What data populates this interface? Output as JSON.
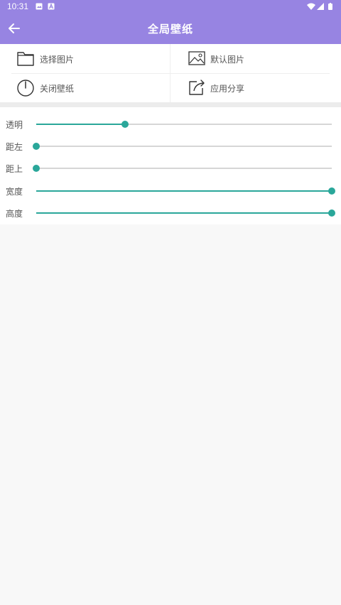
{
  "status_bar": {
    "time": "10:31"
  },
  "app_bar": {
    "title": "全局壁纸"
  },
  "actions": [
    {
      "label": "选择图片",
      "icon": "folder-icon"
    },
    {
      "label": "默认图片",
      "icon": "image-icon"
    },
    {
      "label": "关闭壁纸",
      "icon": "power-icon"
    },
    {
      "label": "应用分享",
      "icon": "share-icon"
    }
  ],
  "sliders": [
    {
      "label": "透明",
      "value": 0.3
    },
    {
      "label": "距左",
      "value": 0.0
    },
    {
      "label": "距上",
      "value": 0.0
    },
    {
      "label": "宽度",
      "value": 1.0
    },
    {
      "label": "高度",
      "value": 1.0
    }
  ],
  "colors": {
    "app_bar": "#9784e2",
    "accent": "#2aa79a"
  }
}
